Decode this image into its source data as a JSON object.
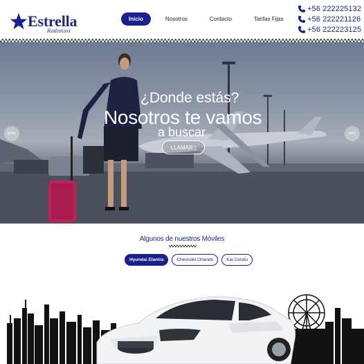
{
  "brand": {
    "name": "Estrella",
    "tagline": "Radiotaxi"
  },
  "nav": {
    "items": [
      {
        "label": "Inicio",
        "active": true
      },
      {
        "label": "Nosotros",
        "active": false
      },
      {
        "label": "Contacto",
        "active": false
      },
      {
        "label": "Tarifas Fijas",
        "active": false
      }
    ]
  },
  "contact": {
    "phones": [
      "+56 222225132",
      "+56 222221126",
      "+56 222223125"
    ]
  },
  "hero": {
    "question": "¿Donde estás?",
    "headline": "Nosotros te vamos",
    "subline": "a buscar",
    "cta_label": "LLAMAR !",
    "prev_label": "prev",
    "next_label": "next"
  },
  "fleet": {
    "title": "Algunos de nuestros Móviles",
    "tabs": [
      {
        "label": "Hyundai Elantra",
        "active": true
      },
      {
        "label": "Chevrolet Orlando",
        "active": false
      },
      {
        "label": "Kia Cerato",
        "active": false
      }
    ]
  },
  "colors": {
    "accent": "#1a1f8f",
    "brand_text": "#1f2a7a"
  }
}
